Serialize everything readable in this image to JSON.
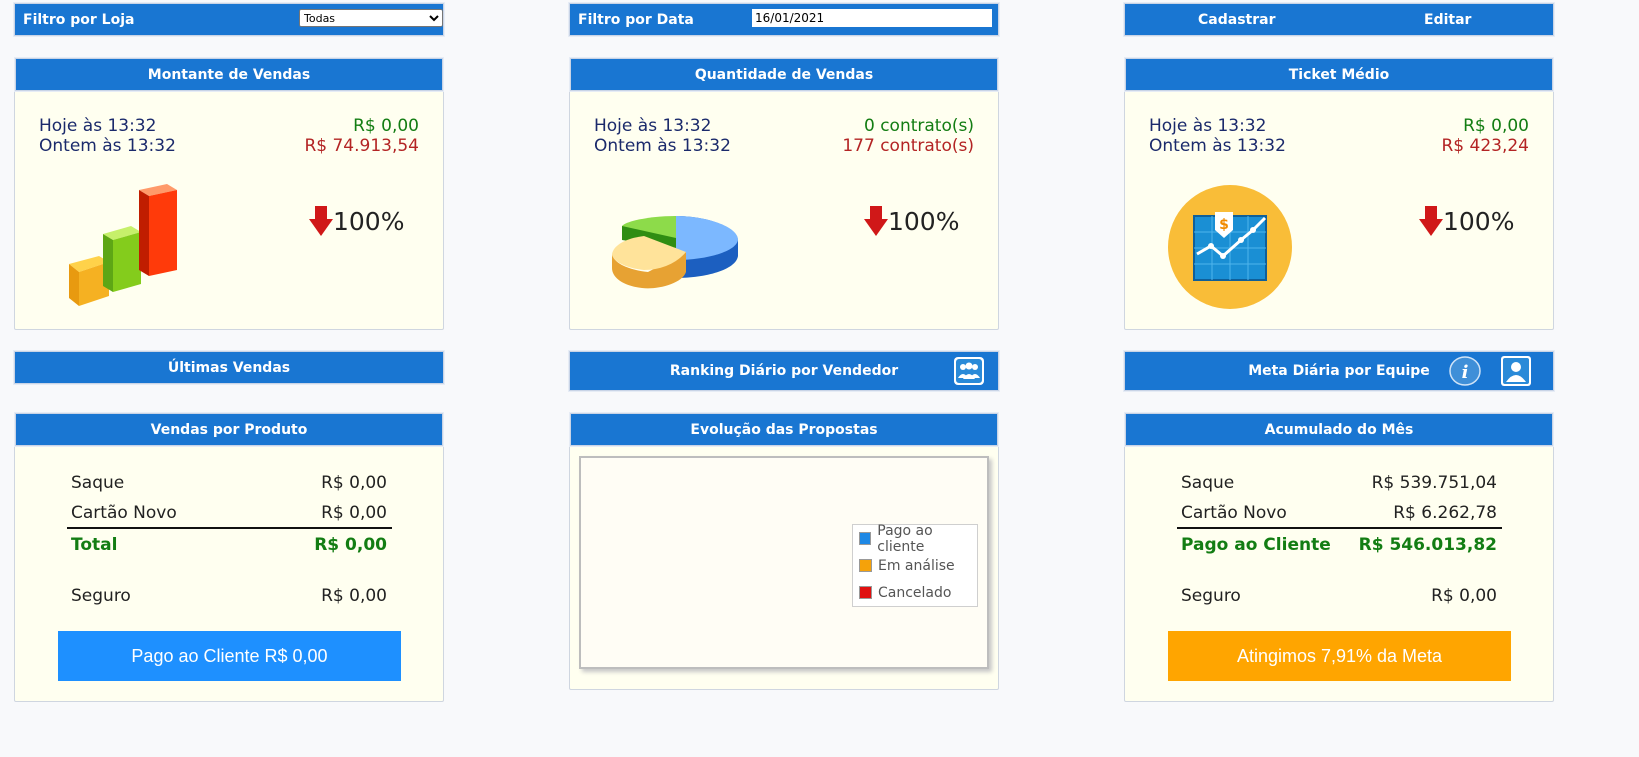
{
  "filters": {
    "store_label": "Filtro por Loja",
    "store_selected": "Todas",
    "date_label": "Filtro por Data",
    "date_value": "16/01/2021",
    "cadastrar": "Cadastrar",
    "editar": "Editar"
  },
  "montante": {
    "title": "Montante de Vendas",
    "today_label": "Hoje às 13:32",
    "today_value": "R$ 0,00",
    "yesterday_label": "Ontem às 13:32",
    "yesterday_value": "R$ 74.913,54",
    "change": "100%"
  },
  "quantidade": {
    "title": "Quantidade de Vendas",
    "today_label": "Hoje às 13:32",
    "today_value": "0 contrato(s)",
    "yesterday_label": "Ontem às 13:32",
    "yesterday_value": "177 contrato(s)",
    "change": "100%"
  },
  "ticket": {
    "title": "Ticket Médio",
    "today_label": "Hoje às 13:32",
    "today_value": "R$ 0,00",
    "yesterday_label": "Ontem às 13:32",
    "yesterday_value": "R$ 423,24",
    "change": "100%"
  },
  "ultimas": {
    "title": "Últimas Vendas"
  },
  "ranking": {
    "title": "Ranking Diário por Vendedor"
  },
  "meta_diaria": {
    "title": "Meta Diária por Equipe"
  },
  "produto": {
    "title": "Vendas por Produto",
    "rows": [
      {
        "label": "Saque",
        "value": "R$ 0,00"
      },
      {
        "label": "Cartão Novo",
        "value": "R$ 0,00"
      }
    ],
    "total_label": "Total",
    "total_value": "R$ 0,00",
    "seguro_label": "Seguro",
    "seguro_value": "R$ 0,00",
    "button": "Pago ao Cliente R$ 0,00"
  },
  "evolucao": {
    "title": "Evolução das Propostas",
    "legend": [
      {
        "name": "Pago ao cliente",
        "color": "#1e88e5"
      },
      {
        "name": "Em análise",
        "color": "#f5a20a"
      },
      {
        "name": "Cancelado",
        "color": "#e01010"
      }
    ]
  },
  "acumulado": {
    "title": "Acumulado do Mês",
    "rows": [
      {
        "label": "Saque",
        "value": "R$ 539.751,04"
      },
      {
        "label": "Cartão Novo",
        "value": "R$ 6.262,78"
      }
    ],
    "total_label": "Pago ao Cliente",
    "total_value": "R$ 546.013,82",
    "seguro_label": "Seguro",
    "seguro_value": "R$ 0,00",
    "button": "Atingimos 7,91% da Meta"
  },
  "colors": {
    "header": "#1976d2",
    "panel": "#fffff0",
    "blue_button": "#1e90ff",
    "orange_button": "#ffa500"
  }
}
